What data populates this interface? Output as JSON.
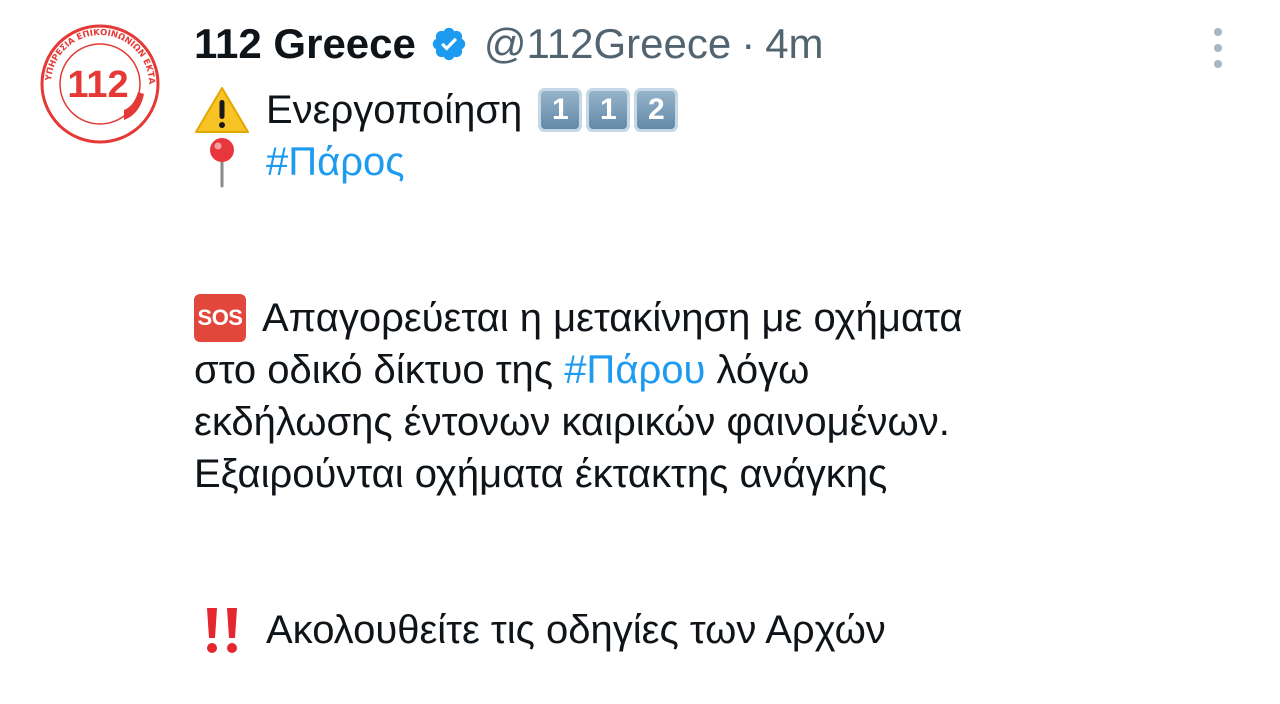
{
  "author": {
    "name": "112 Greece",
    "handle": "@112Greece",
    "separator": "·",
    "time": "4m",
    "avatar_icon": "112-logo-icon",
    "avatar_ring_text": "ΥΠΗΡΕΣΙΑ ΕΠΙΚΟΙΝΩΝΙΩΝ ΕΚΤΑΚΤΟΥ ΑΝΑΓΚΗΣ",
    "avatar_number": "112",
    "verified_icon": "verified-badge-icon"
  },
  "menu": {
    "icon": "more-vertical-icon"
  },
  "tweet": {
    "line1": {
      "icon": "warning-icon",
      "text": "Ενεργοποίηση",
      "keycaps": [
        "1",
        "1",
        "2"
      ]
    },
    "line2": {
      "icon": "round-pushpin-icon",
      "hashtag": "#Πάρος"
    },
    "paragraph": {
      "icon": "sos-icon",
      "sos_label": "SOS",
      "l1": "Απαγορεύεται η μετακίνηση με οχήματα",
      "l2_before": "στο οδικό δίκτυο της ",
      "l2_hashtag": "#Πάρου",
      "l2_after": " λόγω",
      "l3": "εκδήλωσης έντονων καιρικών φαινομένων.",
      "l4": "Εξαιρούνται οχήματα έκτακτης ανάγκης"
    },
    "closing": {
      "icon": "double-exclamation-icon",
      "text": "Ακολουθείτε τις οδηγίες των Αρχών"
    }
  },
  "colors": {
    "text": "#0f1419",
    "muted": "#536471",
    "link": "#1d9bf0",
    "verified": "#1d9bf0",
    "brand_red": "#e53935"
  }
}
